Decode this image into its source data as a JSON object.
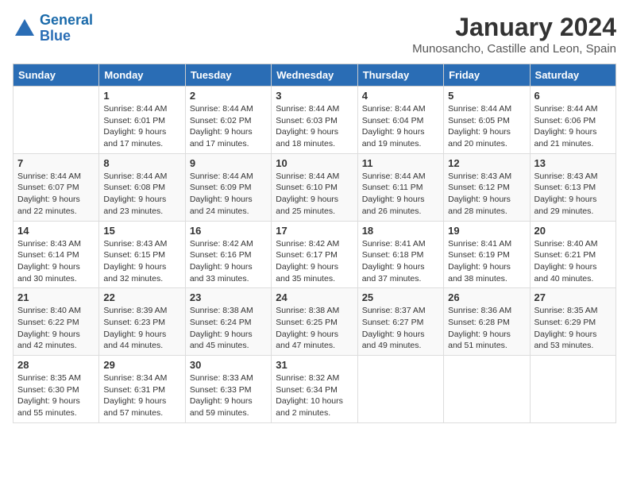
{
  "header": {
    "logo_line1": "General",
    "logo_line2": "Blue",
    "month": "January 2024",
    "location": "Munosancho, Castille and Leon, Spain"
  },
  "days_of_week": [
    "Sunday",
    "Monday",
    "Tuesday",
    "Wednesday",
    "Thursday",
    "Friday",
    "Saturday"
  ],
  "weeks": [
    [
      {
        "day": "",
        "info": ""
      },
      {
        "day": "1",
        "info": "Sunrise: 8:44 AM\nSunset: 6:01 PM\nDaylight: 9 hours\nand 17 minutes."
      },
      {
        "day": "2",
        "info": "Sunrise: 8:44 AM\nSunset: 6:02 PM\nDaylight: 9 hours\nand 17 minutes."
      },
      {
        "day": "3",
        "info": "Sunrise: 8:44 AM\nSunset: 6:03 PM\nDaylight: 9 hours\nand 18 minutes."
      },
      {
        "day": "4",
        "info": "Sunrise: 8:44 AM\nSunset: 6:04 PM\nDaylight: 9 hours\nand 19 minutes."
      },
      {
        "day": "5",
        "info": "Sunrise: 8:44 AM\nSunset: 6:05 PM\nDaylight: 9 hours\nand 20 minutes."
      },
      {
        "day": "6",
        "info": "Sunrise: 8:44 AM\nSunset: 6:06 PM\nDaylight: 9 hours\nand 21 minutes."
      }
    ],
    [
      {
        "day": "7",
        "info": "Sunrise: 8:44 AM\nSunset: 6:07 PM\nDaylight: 9 hours\nand 22 minutes."
      },
      {
        "day": "8",
        "info": "Sunrise: 8:44 AM\nSunset: 6:08 PM\nDaylight: 9 hours\nand 23 minutes."
      },
      {
        "day": "9",
        "info": "Sunrise: 8:44 AM\nSunset: 6:09 PM\nDaylight: 9 hours\nand 24 minutes."
      },
      {
        "day": "10",
        "info": "Sunrise: 8:44 AM\nSunset: 6:10 PM\nDaylight: 9 hours\nand 25 minutes."
      },
      {
        "day": "11",
        "info": "Sunrise: 8:44 AM\nSunset: 6:11 PM\nDaylight: 9 hours\nand 26 minutes."
      },
      {
        "day": "12",
        "info": "Sunrise: 8:43 AM\nSunset: 6:12 PM\nDaylight: 9 hours\nand 28 minutes."
      },
      {
        "day": "13",
        "info": "Sunrise: 8:43 AM\nSunset: 6:13 PM\nDaylight: 9 hours\nand 29 minutes."
      }
    ],
    [
      {
        "day": "14",
        "info": "Sunrise: 8:43 AM\nSunset: 6:14 PM\nDaylight: 9 hours\nand 30 minutes."
      },
      {
        "day": "15",
        "info": "Sunrise: 8:43 AM\nSunset: 6:15 PM\nDaylight: 9 hours\nand 32 minutes."
      },
      {
        "day": "16",
        "info": "Sunrise: 8:42 AM\nSunset: 6:16 PM\nDaylight: 9 hours\nand 33 minutes."
      },
      {
        "day": "17",
        "info": "Sunrise: 8:42 AM\nSunset: 6:17 PM\nDaylight: 9 hours\nand 35 minutes."
      },
      {
        "day": "18",
        "info": "Sunrise: 8:41 AM\nSunset: 6:18 PM\nDaylight: 9 hours\nand 37 minutes."
      },
      {
        "day": "19",
        "info": "Sunrise: 8:41 AM\nSunset: 6:19 PM\nDaylight: 9 hours\nand 38 minutes."
      },
      {
        "day": "20",
        "info": "Sunrise: 8:40 AM\nSunset: 6:21 PM\nDaylight: 9 hours\nand 40 minutes."
      }
    ],
    [
      {
        "day": "21",
        "info": "Sunrise: 8:40 AM\nSunset: 6:22 PM\nDaylight: 9 hours\nand 42 minutes."
      },
      {
        "day": "22",
        "info": "Sunrise: 8:39 AM\nSunset: 6:23 PM\nDaylight: 9 hours\nand 44 minutes."
      },
      {
        "day": "23",
        "info": "Sunrise: 8:38 AM\nSunset: 6:24 PM\nDaylight: 9 hours\nand 45 minutes."
      },
      {
        "day": "24",
        "info": "Sunrise: 8:38 AM\nSunset: 6:25 PM\nDaylight: 9 hours\nand 47 minutes."
      },
      {
        "day": "25",
        "info": "Sunrise: 8:37 AM\nSunset: 6:27 PM\nDaylight: 9 hours\nand 49 minutes."
      },
      {
        "day": "26",
        "info": "Sunrise: 8:36 AM\nSunset: 6:28 PM\nDaylight: 9 hours\nand 51 minutes."
      },
      {
        "day": "27",
        "info": "Sunrise: 8:35 AM\nSunset: 6:29 PM\nDaylight: 9 hours\nand 53 minutes."
      }
    ],
    [
      {
        "day": "28",
        "info": "Sunrise: 8:35 AM\nSunset: 6:30 PM\nDaylight: 9 hours\nand 55 minutes."
      },
      {
        "day": "29",
        "info": "Sunrise: 8:34 AM\nSunset: 6:31 PM\nDaylight: 9 hours\nand 57 minutes."
      },
      {
        "day": "30",
        "info": "Sunrise: 8:33 AM\nSunset: 6:33 PM\nDaylight: 9 hours\nand 59 minutes."
      },
      {
        "day": "31",
        "info": "Sunrise: 8:32 AM\nSunset: 6:34 PM\nDaylight: 10 hours\nand 2 minutes."
      },
      {
        "day": "",
        "info": ""
      },
      {
        "day": "",
        "info": ""
      },
      {
        "day": "",
        "info": ""
      }
    ]
  ]
}
